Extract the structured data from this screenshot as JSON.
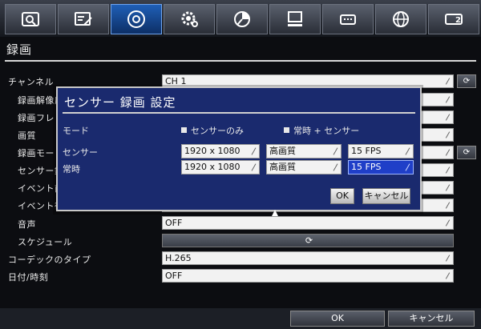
{
  "tabs": [
    {
      "icon": "camera-search-icon"
    },
    {
      "icon": "edit-display-icon"
    },
    {
      "icon": "record-disc-icon",
      "active": true
    },
    {
      "icon": "settings-gear-icon"
    },
    {
      "icon": "pie-chart-icon"
    },
    {
      "icon": "computer-icon"
    },
    {
      "icon": "device-icon"
    },
    {
      "icon": "network-globe-icon"
    },
    {
      "icon": "system-badge-icon",
      "badge": "2"
    }
  ],
  "section": {
    "title": "録画"
  },
  "settings": {
    "channel": {
      "label": "チャンネル",
      "value": "CH 1"
    },
    "resolution": {
      "label": "録画解像度"
    },
    "frame_rate": {
      "label": "録画フレ"
    },
    "quality": {
      "label": "画質"
    },
    "mode": {
      "label": "録画モー"
    },
    "sensor": {
      "label": "センサー録"
    },
    "event_pre": {
      "label": "イベント前"
    },
    "event_post": {
      "label": "イベント後"
    },
    "audio": {
      "label": "音声",
      "value": "OFF"
    },
    "schedule": {
      "label": "スケジュール",
      "value": "⟳"
    },
    "codec": {
      "label": "コーデックのタイプ",
      "value": "H.265"
    },
    "datetime": {
      "label": "日付/時刻",
      "value": "OFF"
    }
  },
  "copy_button": "⟳",
  "footer": {
    "ok": "OK",
    "cancel": "キャンセル"
  },
  "dialog": {
    "title": "センサー 録画 設定",
    "mode_label": "モード",
    "mode_option_1": "センサーのみ",
    "mode_option_2": "常時 + センサー",
    "sensor_label": "センサー",
    "sensor_resolution": "1920 x 1080",
    "sensor_quality": "高画質",
    "sensor_fps": "15 FPS",
    "always_label": "常時",
    "always_resolution": "1920 x 1080",
    "always_quality": "高画質",
    "always_fps": "15 FPS",
    "ok": "OK",
    "cancel": "キャンセル"
  },
  "colors": {
    "accent": "#1f5fb6",
    "dialog_bg": "#1a2a6e",
    "highlight": "#1f3fc8"
  }
}
